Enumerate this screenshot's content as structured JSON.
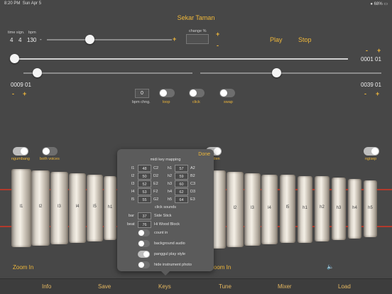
{
  "status": {
    "time": "8:20 PM",
    "date": "Sun Apr 5",
    "battery": "68%"
  },
  "title": "Sekar Taman",
  "tempo": {
    "time_sign_label": "time sign.",
    "bpm_label": "bpm",
    "time_sign_num": "4",
    "time_sign_den": "4",
    "bpm_value": "130",
    "minus": "-",
    "plus": "+",
    "change_label": "change %",
    "change_plus": "+",
    "change_minus": "-",
    "slider_level": 0.34
  },
  "transport": {
    "play": "Play",
    "stop": "Stop",
    "minus": "-",
    "plus": "+",
    "position": "0001 01",
    "position_level": 0.0
  },
  "range": {
    "start": "0009 01",
    "end": "0039 01",
    "start_minus": "-",
    "start_plus": "+",
    "end_minus": "-",
    "end_plus": "+",
    "start_level": 0.08,
    "end_level": 0.42
  },
  "controls": {
    "bpm_chng_value": "0",
    "bpm_chng_label": "bpm chng.",
    "loop_label": "loop",
    "click_label": "click",
    "swap_label": "swap"
  },
  "voices": {
    "ngumbang": "ngumbang",
    "both": "both voices",
    "ngisep": "ngisep",
    "left_partial": "ilen"
  },
  "instrument": {
    "left_bars": [
      "l1",
      "l2",
      "l3",
      "l4",
      "l5",
      "h1",
      "",
      ""
    ],
    "right_bars": [
      "",
      "l2",
      "l3",
      "l4",
      "l5",
      "h1",
      "h2",
      "h3",
      "h4",
      "h5"
    ]
  },
  "zoom": {
    "left": "Zoom In",
    "right": "Zoom In"
  },
  "tabs": [
    "Info",
    "Save",
    "Keys",
    "Tune",
    "Mixer",
    "Load"
  ],
  "popup": {
    "done": "Done",
    "heading": "midi key mapping",
    "left_map": [
      {
        "key": "l1",
        "num": "48",
        "note": "C2"
      },
      {
        "key": "l2",
        "num": "50",
        "note": "D2"
      },
      {
        "key": "l3",
        "num": "52",
        "note": "E2"
      },
      {
        "key": "l4",
        "num": "53",
        "note": "F2"
      },
      {
        "key": "l5",
        "num": "55",
        "note": "G2"
      }
    ],
    "right_map": [
      {
        "key": "h1",
        "num": "57",
        "note": "A2"
      },
      {
        "key": "h2",
        "num": "59",
        "note": "B2"
      },
      {
        "key": "h3",
        "num": "60",
        "note": "C3"
      },
      {
        "key": "h4",
        "num": "62",
        "note": "D3"
      },
      {
        "key": "h5",
        "num": "64",
        "note": "E3"
      }
    ],
    "click_heading": "click sounds",
    "bar_label": "bar",
    "bar_num": "37",
    "bar_sound": "Side Stick",
    "beat_label": "beat",
    "beat_num": "76",
    "beat_sound": "Hi Wood Block",
    "options": [
      {
        "label": "count in",
        "on": false
      },
      {
        "label": "background audio",
        "on": false
      },
      {
        "label": "panggul play style",
        "on": true
      },
      {
        "label": "hide instrument photo",
        "on": false
      }
    ]
  }
}
